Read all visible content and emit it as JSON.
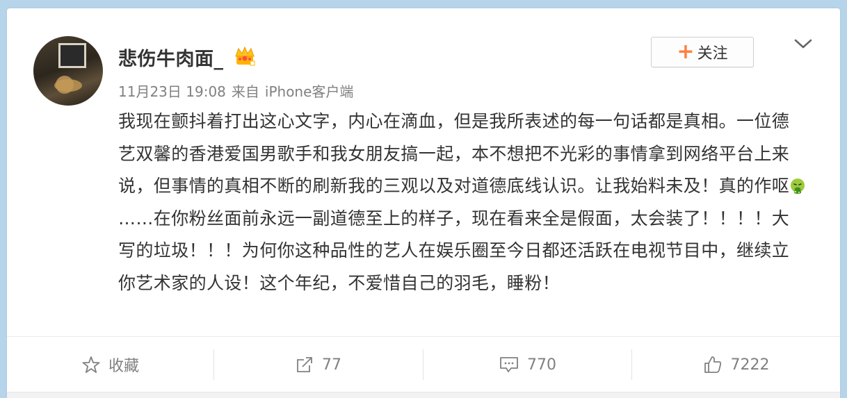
{
  "post": {
    "username": "悲伤牛肉面_",
    "badge_icon": "crown-vip-icon",
    "timestamp": "11月23日 19:08",
    "source_prefix": "来自",
    "source": "iPhone客户端",
    "follow_label": "关注",
    "text_before_emoji": "我现在颤抖着打出这心文字，内心在滴血，但是我所表述的每一句话都是真相。一位德艺双馨的香港爱国男歌手和我女朋友搞一起，本不想把不光彩的事情拿到网络平台上来说，但事情的真相不断的刷新我的三观以及对道德底线认识。让我始料未及！真的作呕",
    "text_after_emoji": "……在你粉丝面前永远一副道德至上的样子，现在看来全是假面，太会装了！！！！大写的垃圾！！！为何你这种品性的艺人在娱乐圈至今日都还活跃在电视节目中，继续立你艺术家的人设！这个年纪，不爱惜自己的羽毛，睡粉！"
  },
  "actions": {
    "favorite_label": "收藏",
    "repost_count": "77",
    "comment_count": "770",
    "like_count": "7222"
  },
  "colors": {
    "page_background": "#b6d4ea",
    "accent_orange": "#ff8140",
    "text_main": "#333333",
    "text_muted": "#808080"
  }
}
